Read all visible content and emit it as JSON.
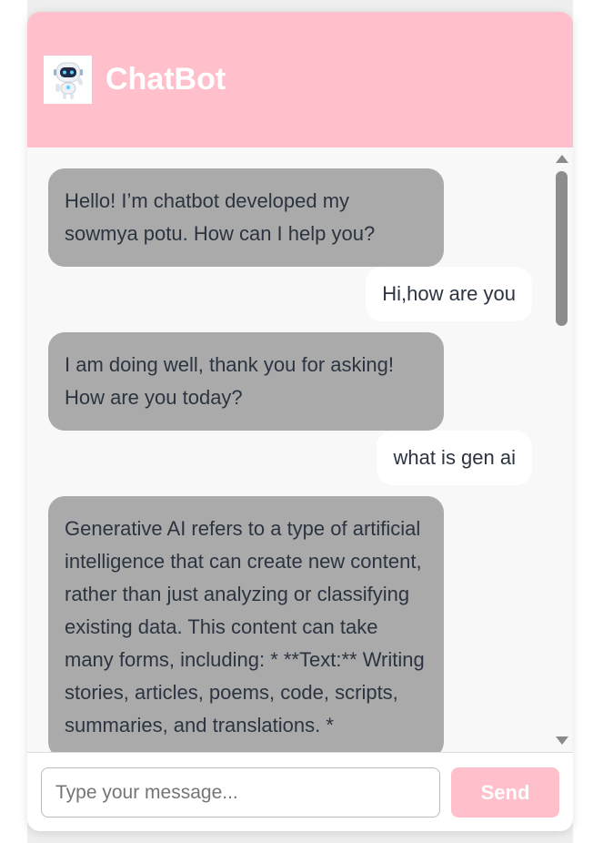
{
  "header": {
    "title": "ChatBot",
    "avatar_icon": "robot-icon",
    "accent_color": "#ffc0cb"
  },
  "messages": [
    {
      "sender": "bot",
      "text": "Hello! I’m chatbot developed my sowmya potu. How can I help you?"
    },
    {
      "sender": "user",
      "text": "Hi,how are you"
    },
    {
      "sender": "bot",
      "text": "I am doing well, thank you for asking! How are you today?"
    },
    {
      "sender": "user",
      "text": "what is gen ai"
    },
    {
      "sender": "bot",
      "text": "Generative AI refers to a type of artificial intelligence that can create new content, rather than just analyzing or classifying existing data. This content can take many forms, including: * **Text:** Writing stories, articles, poems, code, scripts, summaries, and translations. *"
    }
  ],
  "input": {
    "placeholder": "Type your message...",
    "value": ""
  },
  "send_button": {
    "label": "Send"
  },
  "colors": {
    "bot_bubble": "#aaaaaa",
    "user_bubble": "#ffffff",
    "message_text": "#2b3440"
  }
}
